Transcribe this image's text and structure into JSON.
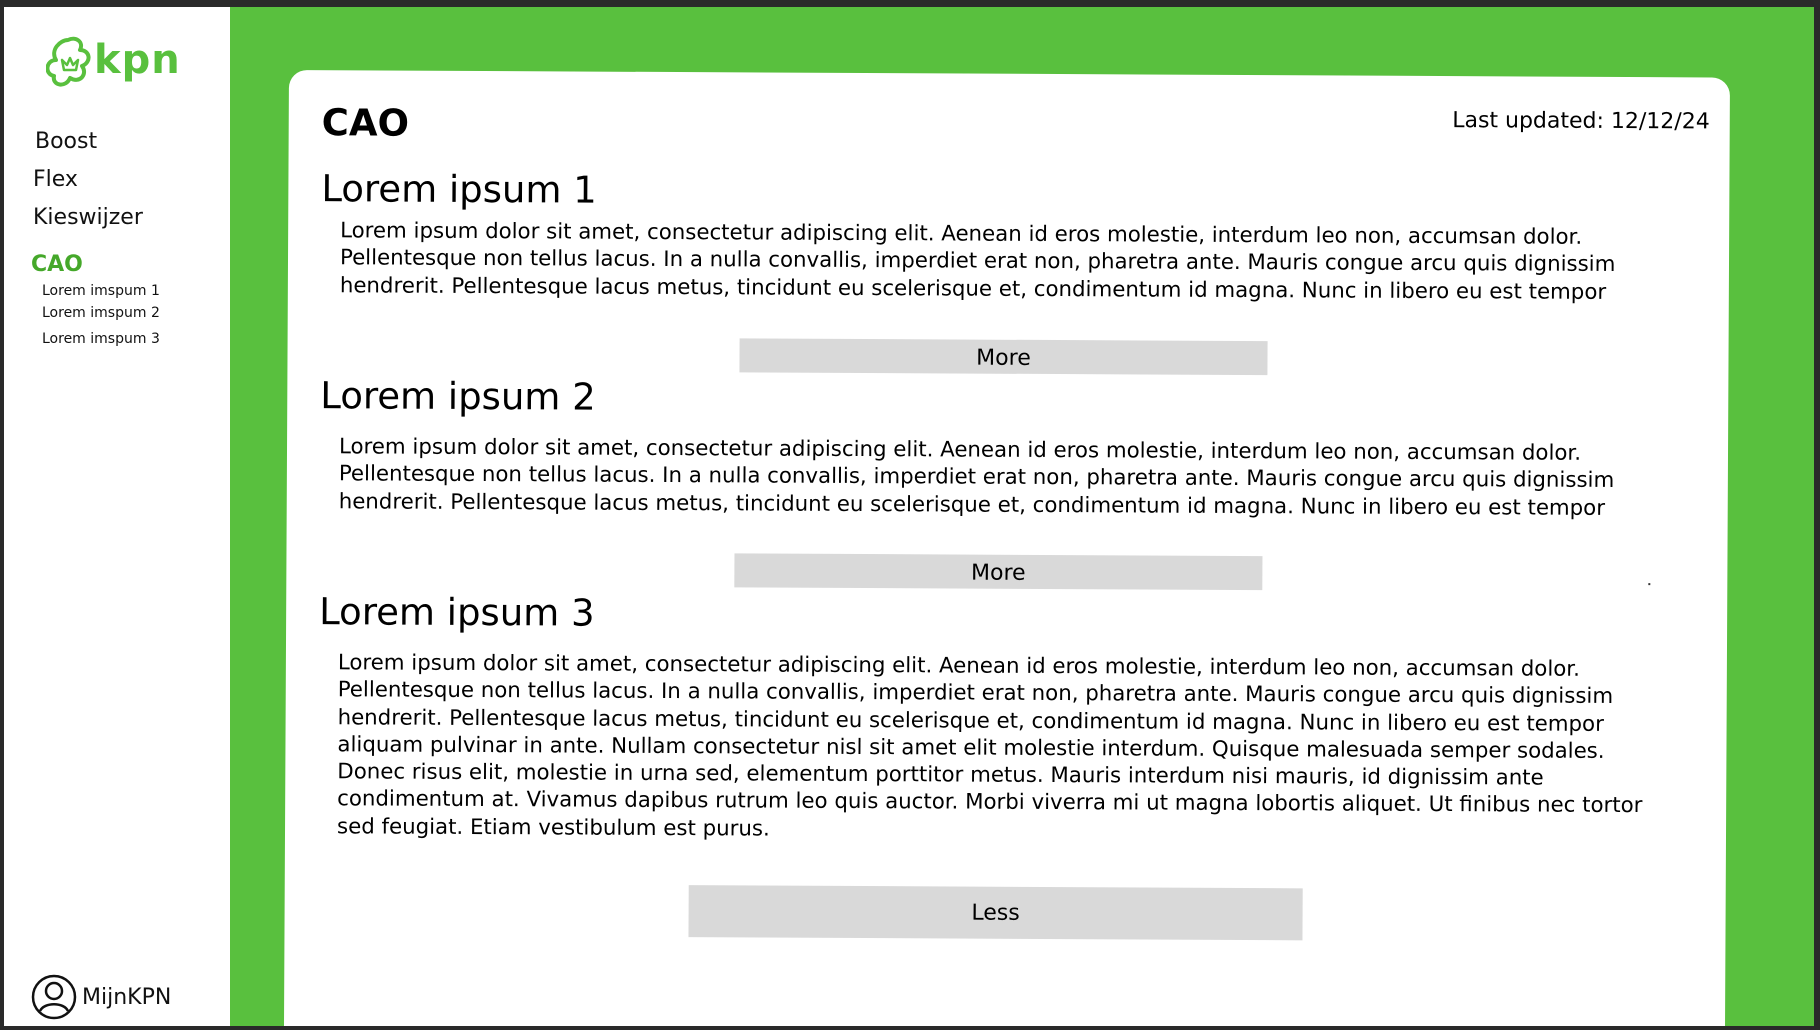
{
  "brand": {
    "name": "kpn",
    "color": "#59c03e",
    "logo_icon": "kpn-crown-logo"
  },
  "sidebar": {
    "items": [
      {
        "label": "Boost"
      },
      {
        "label": "Flex"
      },
      {
        "label": "Kieswijzer"
      },
      {
        "label": "CAO"
      }
    ],
    "active": "CAO",
    "subitems": [
      {
        "label": "Lorem imspum 1"
      },
      {
        "label": "Lorem imspum 2"
      },
      {
        "label": "Lorem imspum 3"
      }
    ],
    "account": {
      "label": "MijnKPN",
      "icon": "user-icon"
    }
  },
  "main": {
    "title": "CAO",
    "last_updated": "Last updated: 12/12/24",
    "sections": [
      {
        "title": "Lorem ipsum 1",
        "text": "Lorem ipsum dolor sit amet, consectetur adipiscing elit. Aenean id eros molestie, interdum leo non, accumsan dolor. Pellentesque non tellus lacus. In a nulla convallis, imperdiet erat non, pharetra ante. Mauris congue arcu quis dignissim hendrerit. Pellentesque lacus metus, tincidunt eu scelerisque et, condimentum id magna. Nunc in libero eu est tempor",
        "button": "More"
      },
      {
        "title": "Lorem ipsum 2",
        "text": "Lorem ipsum dolor sit amet, consectetur adipiscing elit. Aenean id eros molestie, interdum leo non, accumsan dolor. Pellentesque non tellus lacus. In a nulla convallis, imperdiet erat non, pharetra ante. Mauris congue arcu quis dignissim hendrerit. Pellentesque lacus metus, tincidunt eu scelerisque et, condimentum id magna. Nunc in libero eu est tempor",
        "button": "More"
      },
      {
        "title": "Lorem ipsum 3",
        "text": "Lorem ipsum dolor sit amet, consectetur adipiscing elit. Aenean id eros molestie, interdum leo non, accumsan dolor. Pellentesque non tellus lacus. In a nulla convallis, imperdiet erat non, pharetra ante. Mauris congue arcu quis dignissim hendrerit. Pellentesque lacus metus, tincidunt eu scelerisque et, condimentum id magna. Nunc in libero eu est tempor aliquam pulvinar in ante. Nullam consectetur nisl sit amet elit molestie interdum. Quisque malesuada semper sodales. Donec risus elit, molestie in urna sed, elementum porttitor metus. Mauris interdum nisi mauris, id dignissim ante condimentum at. Vivamus dapibus rutrum leo quis auctor. Morbi viverra mi ut magna lobortis aliquet. Ut finibus nec tortor sed feugiat. Etiam vestibulum est purus.",
        "button": "Less"
      }
    ]
  },
  "colors": {
    "background_green": "#59c03e",
    "active_nav": "#45a82a",
    "button_gray": "#d9d9d9"
  }
}
